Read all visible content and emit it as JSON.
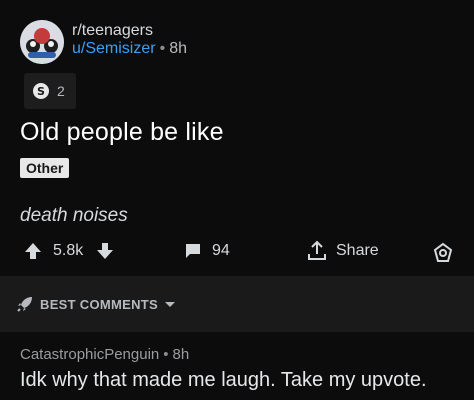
{
  "post": {
    "subreddit": "r/teenagers",
    "username": "u/Semisizer",
    "separator": "•",
    "time": "8h",
    "award_count": "2",
    "title": "Old people be like",
    "flair": "Other",
    "body": "death noises"
  },
  "actions": {
    "score": "5.8k",
    "comments": "94",
    "share": "Share"
  },
  "sort": {
    "label": "BEST COMMENTS"
  },
  "comment": {
    "author": "CatastrophicPenguin",
    "separator": "•",
    "time": "8h",
    "text": "Idk why that made me laugh. Take my upvote."
  },
  "colors": {
    "background": "#000000",
    "post_bg": "#0c0c0c",
    "sort_bg": "#1a1a1b",
    "username": "#3aa0f5",
    "flair_bg": "#e8e8e8"
  },
  "icons": [
    "subreddit-avatar",
    "silver-award-icon",
    "upvote-icon",
    "downvote-icon",
    "comment-icon",
    "share-icon",
    "award-icon",
    "rocket-icon",
    "chevron-down-icon"
  ]
}
